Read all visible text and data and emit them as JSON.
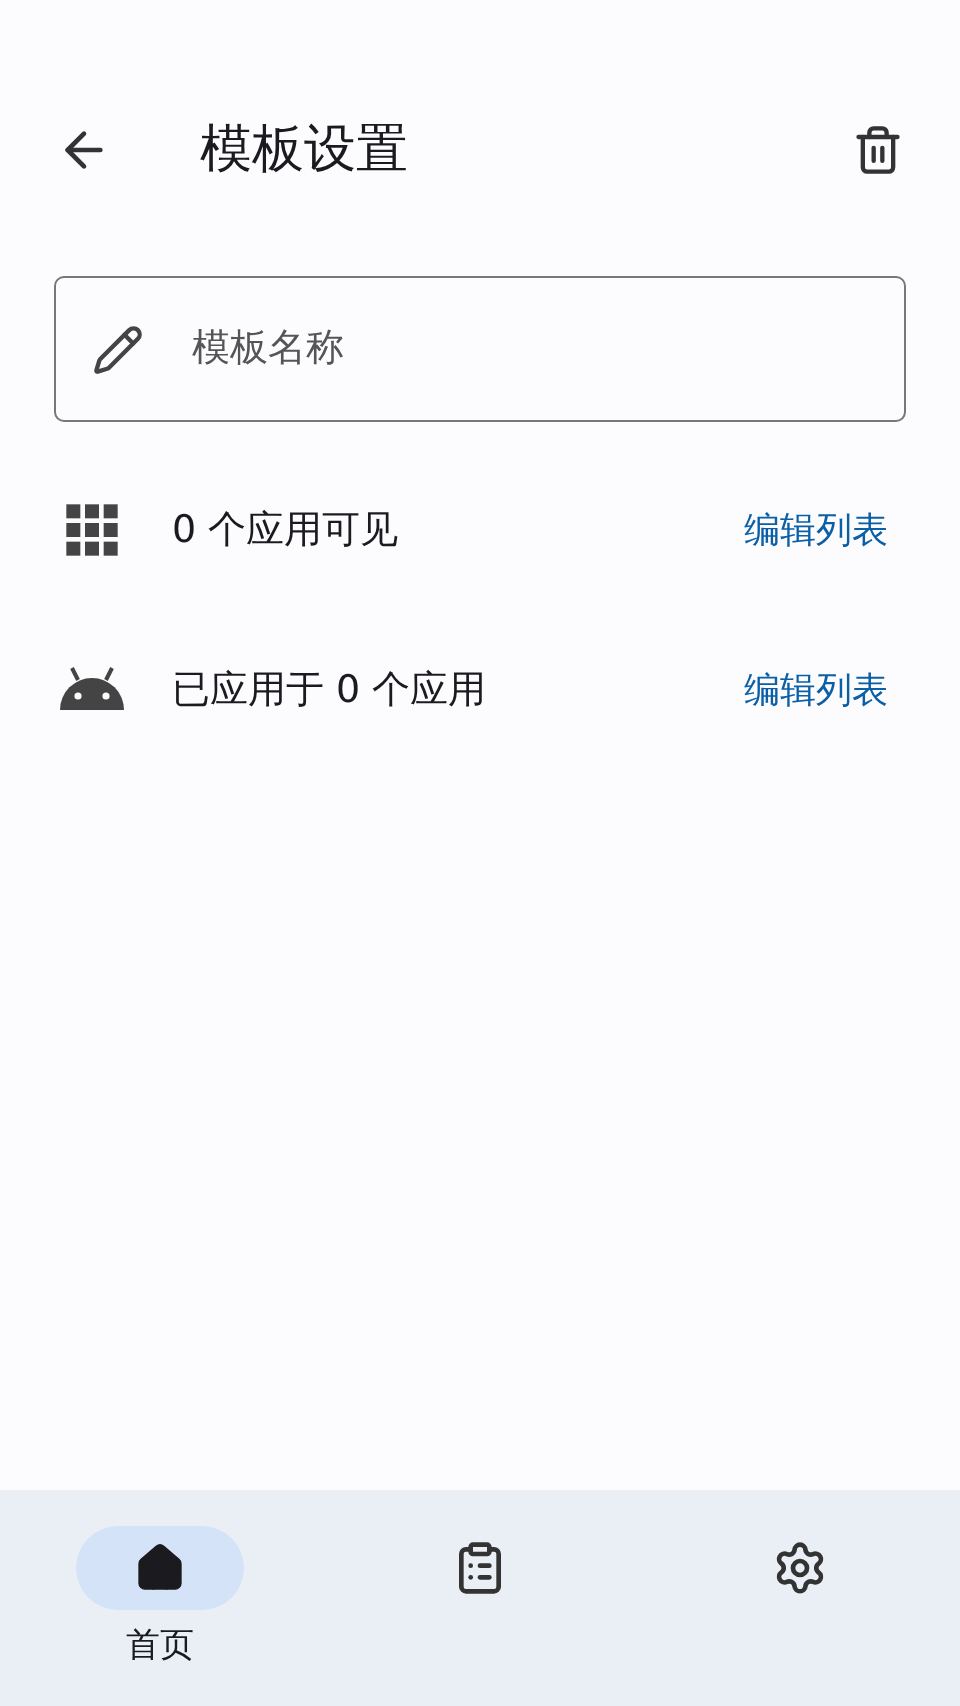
{
  "header": {
    "title": "模板设置"
  },
  "name_field": {
    "placeholder": "模板名称"
  },
  "rows": [
    {
      "kind": "grid",
      "text": "0 个应用可见",
      "action": "编辑列表"
    },
    {
      "kind": "android",
      "text": "已应用于 0 个应用",
      "action": "编辑列表"
    }
  ],
  "nav": [
    {
      "kind": "home",
      "label": "首页",
      "selected": true
    },
    {
      "kind": "list",
      "selected": false
    },
    {
      "kind": "settings",
      "selected": false
    }
  ]
}
